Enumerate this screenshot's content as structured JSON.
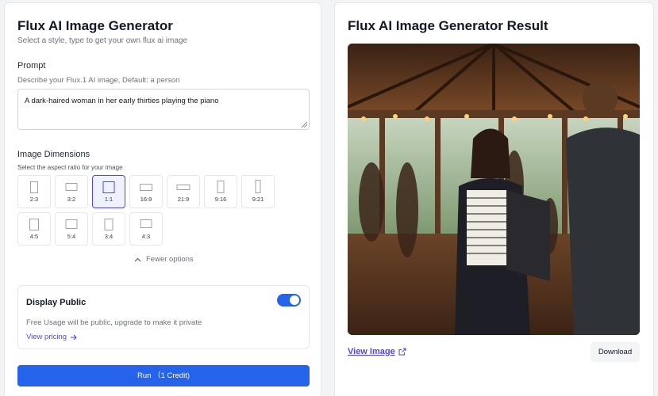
{
  "left": {
    "title": "Flux AI Image Generator",
    "subtitle": "Select a style, type to get your own flux ai image",
    "prompt_label": "Prompt",
    "prompt_hint": "Describe your Flux.1 AI image, Default: a person",
    "prompt_value": "A dark-haired woman in her early thirties playing the piano",
    "dimensions_label": "Image Dimensions",
    "dimensions_hint": "Select the aspect ratio for your image",
    "ratios": [
      "2:3",
      "3:2",
      "1:1",
      "16:9",
      "21:9",
      "9:16",
      "9:21",
      "4:5",
      "5:4",
      "3:4",
      "4:3"
    ],
    "selected_ratio": "1:1",
    "fewer_options": "Fewer options",
    "public": {
      "title": "Display Public",
      "enabled": true,
      "note": "Free Usage will be public, upgrade to make it private",
      "pricing_link": "View pricing"
    },
    "run_label": "Run （1 Credit)"
  },
  "right": {
    "title": "Flux AI Image Generator Result",
    "view_image": "View Image",
    "download": "Download"
  },
  "colors": {
    "accent": "#2563eb",
    "selected": "#4f46e5"
  }
}
